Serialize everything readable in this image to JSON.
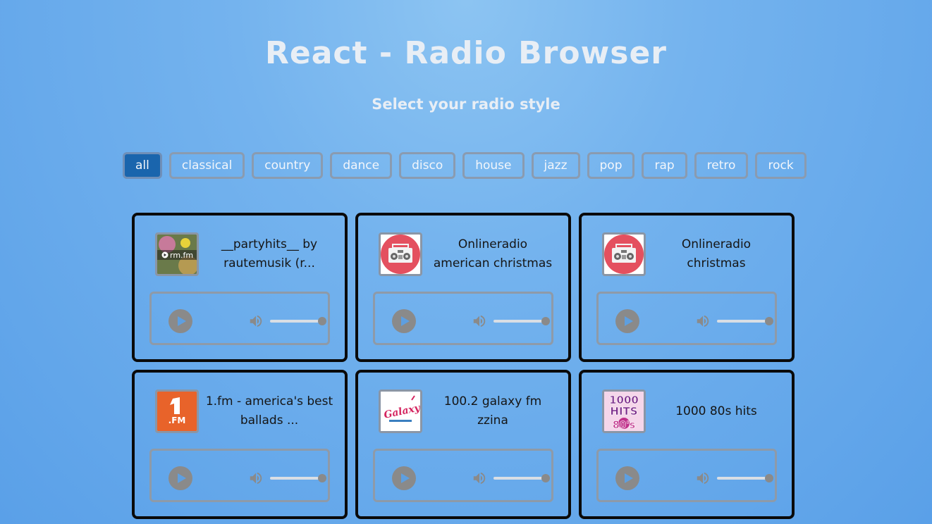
{
  "header": {
    "title": "React - Radio Browser",
    "subtitle": "Select your radio style"
  },
  "filters": {
    "active": "all",
    "items": [
      "all",
      "classical",
      "country",
      "dance",
      "disco",
      "house",
      "jazz",
      "pop",
      "rap",
      "retro",
      "rock"
    ]
  },
  "stations": [
    {
      "name": "__partyhits__ by rautemusik (r...",
      "logo": "rm-fm-logo",
      "volume": 1.0
    },
    {
      "name": "Onlineradio american christmas",
      "logo": "boombox-icon",
      "volume": 1.0
    },
    {
      "name": "Onlineradio christmas",
      "logo": "boombox-icon",
      "volume": 1.0
    },
    {
      "name": "1.fm - america's best ballads ...",
      "logo": "1fm-logo",
      "volume": 1.0
    },
    {
      "name": "100.2 galaxy fm zzina",
      "logo": "galaxy-logo",
      "volume": 1.0
    },
    {
      "name": "1000 80s hits",
      "logo": "1000-hits-80s-logo",
      "volume": 1.0
    }
  ],
  "logo_text": {
    "rm_fm": "rm.fm",
    "one_fm": ".FM",
    "galaxy": "Galaxy",
    "hits_1000": "1000",
    "hits_word": "HITS",
    "hits_80s": "80's"
  },
  "colors": {
    "active_filter": "#1a65ad",
    "boombox_bg": "#e4505f",
    "one_fm_orange": "#e8632a",
    "card_border": "#0a0a0a"
  }
}
